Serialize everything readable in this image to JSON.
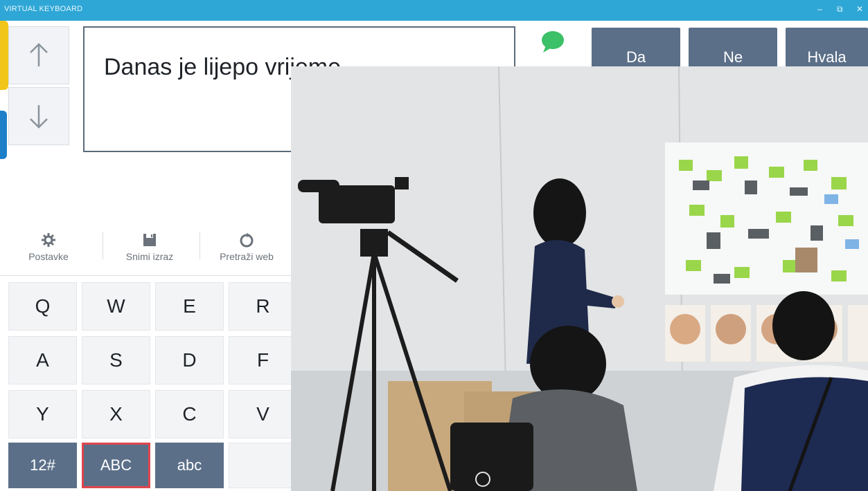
{
  "window": {
    "title": "VIRTUAL KEYBOARD",
    "controls": [
      "‒",
      "⧉",
      "✕"
    ]
  },
  "editor": {
    "text": "Danas je lijepo vrijeme"
  },
  "phrases": [
    "Da",
    "Ne",
    "Hvala"
  ],
  "tools": [
    {
      "label": "Postavke",
      "icon": "gear-icon"
    },
    {
      "label": "Snimi izraz",
      "icon": "save-icon"
    },
    {
      "label": "Pretraži web",
      "icon": "web-search-icon"
    }
  ],
  "keyboard": {
    "row1": [
      "Q",
      "W",
      "E",
      "R"
    ],
    "row2": [
      "A",
      "S",
      "D",
      "F"
    ],
    "row3": [
      "Y",
      "X",
      "C",
      "V"
    ],
    "modes": [
      "12#",
      "ABC",
      "abc"
    ],
    "active_mode": "ABC"
  },
  "colors": {
    "titlebar": "#2fa7d6",
    "key_dark": "#5b6f88",
    "active_border": "#e0464e",
    "speak_icon": "#3cc068"
  }
}
